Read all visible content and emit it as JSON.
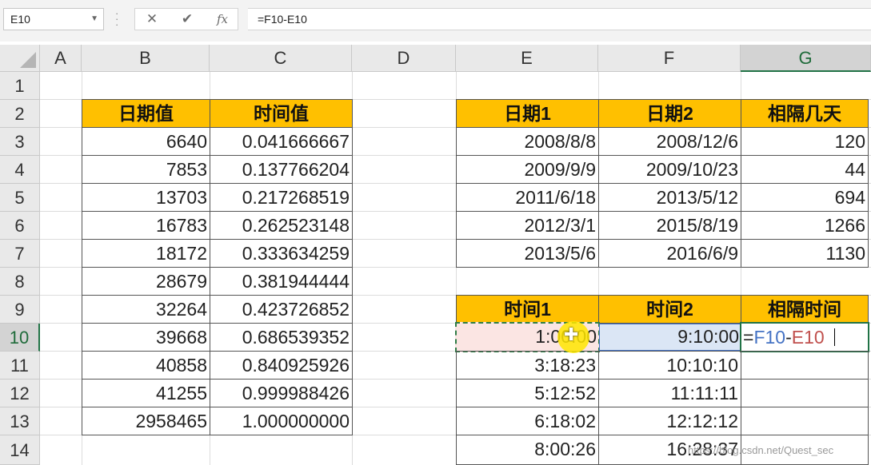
{
  "formula_bar": {
    "name_box": "E10",
    "formula": "=F10-E10"
  },
  "columns": [
    "A",
    "B",
    "C",
    "D",
    "E",
    "F",
    "G"
  ],
  "rows": [
    "1",
    "2",
    "3",
    "4",
    "5",
    "6",
    "7",
    "8",
    "9",
    "10",
    "11",
    "12",
    "13",
    "14"
  ],
  "table1": {
    "headers": [
      "日期值",
      "时间值"
    ],
    "rows": [
      [
        "6640",
        "0.041666667"
      ],
      [
        "7853",
        "0.137766204"
      ],
      [
        "13703",
        "0.217268519"
      ],
      [
        "16783",
        "0.262523148"
      ],
      [
        "18172",
        "0.333634259"
      ],
      [
        "28679",
        "0.381944444"
      ],
      [
        "32264",
        "0.423726852"
      ],
      [
        "39668",
        "0.686539352"
      ],
      [
        "40858",
        "0.840925926"
      ],
      [
        "41255",
        "0.999988426"
      ],
      [
        "2958465",
        "1.000000000"
      ]
    ]
  },
  "table2": {
    "headers": [
      "日期1",
      "日期2",
      "相隔几天"
    ],
    "rows": [
      [
        "2008/8/8",
        "2008/12/6",
        "120"
      ],
      [
        "2009/9/9",
        "2009/10/23",
        "44"
      ],
      [
        "2011/6/18",
        "2013/5/12",
        "694"
      ],
      [
        "2012/3/1",
        "2015/8/19",
        "1266"
      ],
      [
        "2013/5/6",
        "2016/6/9",
        "1130"
      ]
    ]
  },
  "table3": {
    "headers": [
      "时间1",
      "时间2",
      "相隔时间"
    ],
    "rows": [
      [
        "1:00:00",
        "9:10:00"
      ],
      [
        "3:18:23",
        "10:10:10"
      ],
      [
        "5:12:52",
        "11:11:11"
      ],
      [
        "6:18:02",
        "12:12:12"
      ],
      [
        "8:00:26",
        "16:28:37"
      ]
    ]
  },
  "editing": {
    "eq": "=",
    "ref1": "F10",
    "minus": "-",
    "ref2": "E10"
  },
  "watermark": "https://blog.csdn.net/Quest_sec",
  "colors": {
    "header_fill": "#ffc000",
    "selection_green": "#217346",
    "ref_blue": "#4472c4",
    "ref_red": "#c0504d"
  },
  "icons": [
    "dropdown-arrow-icon",
    "cancel-icon",
    "enter-icon",
    "function-icon",
    "select-all-icon"
  ]
}
